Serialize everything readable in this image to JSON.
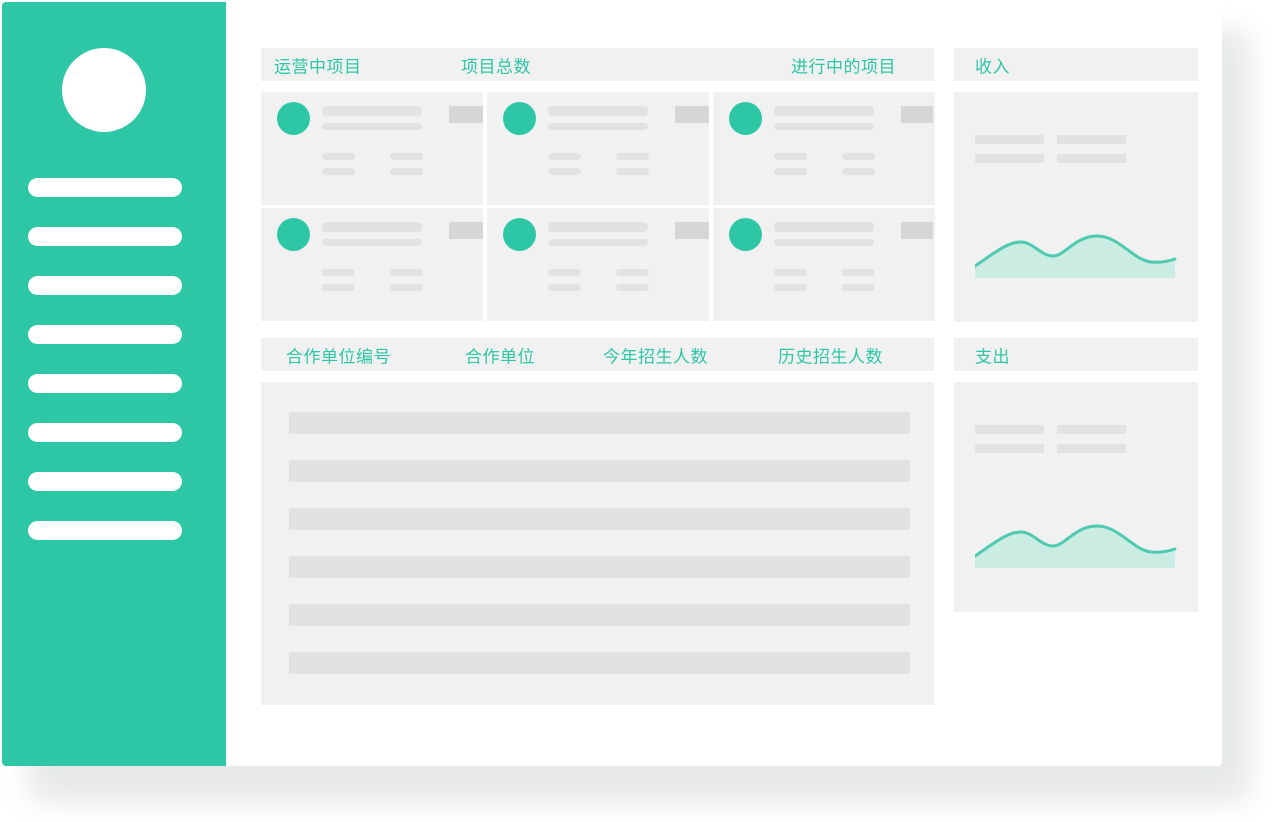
{
  "theme": {
    "accent": "#2ec7a6",
    "panel": "#f1f1f1",
    "placeholder": "#e2e2e2"
  },
  "sidebar": {
    "avatar_icon": "user-avatar",
    "items": [
      "",
      "",
      "",
      "",
      "",
      "",
      "",
      ""
    ]
  },
  "projects": {
    "headers": [
      "运营中项目",
      "项目总数",
      "进行中的项目"
    ],
    "cards": [
      "",
      "",
      "",
      "",
      "",
      ""
    ]
  },
  "partners": {
    "headers": [
      "合作单位编号",
      "合作单位",
      "今年招生人数",
      "历史招生人数"
    ],
    "rows": [
      "",
      "",
      "",
      "",
      "",
      ""
    ]
  },
  "income": {
    "title": "收入"
  },
  "expense": {
    "title": "支出"
  }
}
